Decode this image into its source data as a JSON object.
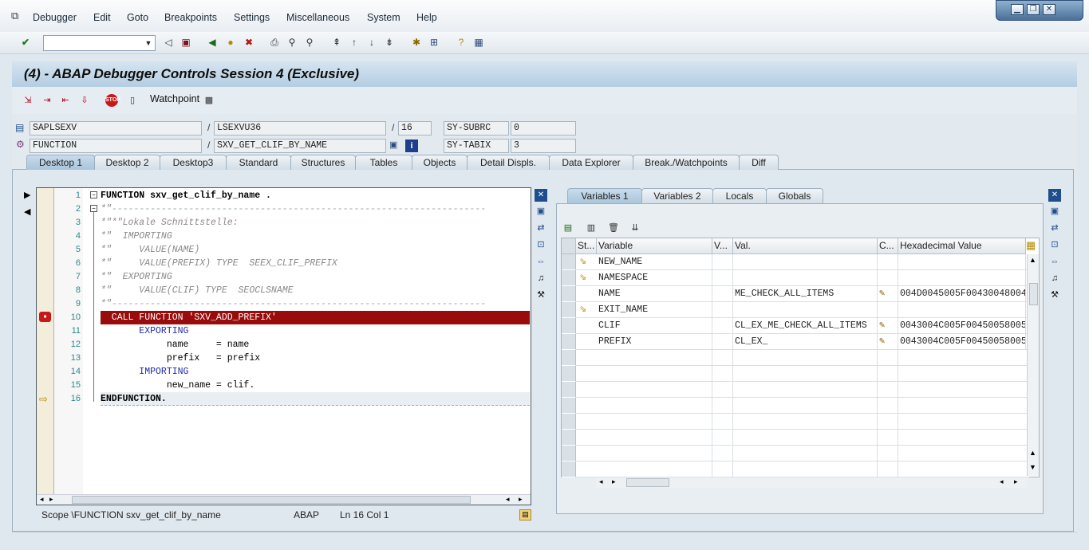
{
  "menubar": {
    "items": [
      "Debugger",
      "Edit",
      "Goto",
      "Breakpoints",
      "Settings",
      "Miscellaneous",
      "System",
      "Help"
    ]
  },
  "window_controls": {
    "minimize": "▁",
    "restore": "❐",
    "close": "✕"
  },
  "toolbar": {
    "command_field": ""
  },
  "header": {
    "title": "(4) - ABAP Debugger Controls Session 4 (Exclusive)"
  },
  "app_toolbar": {
    "watchpoint_label": "Watchpoint"
  },
  "fields": {
    "program": "SAPLSEXV",
    "include": "LSEXVU36",
    "line": "16",
    "event_type": "FUNCTION",
    "event": "SXV_GET_CLIF_BY_NAME",
    "sysvar1_name": "SY-SUBRC",
    "sysvar1_value": "0",
    "sysvar2_name": "SY-TABIX",
    "sysvar2_value": "3",
    "separator": "/"
  },
  "desktop_tabs": [
    "Desktop 1",
    "Desktop 2",
    "Desktop3",
    "Standard",
    "Structures",
    "Tables",
    "Objects",
    "Detail Displs.",
    "Data Explorer",
    "Break./Watchpoints",
    "Diff"
  ],
  "source": {
    "line_numbers": [
      "1",
      "2",
      "3",
      "4",
      "5",
      "6",
      "7",
      "8",
      "9",
      "10",
      "11",
      "12",
      "13",
      "14",
      "15",
      "16"
    ],
    "lines": [
      "FUNCTION sxv_get_clif_by_name .",
      "*\"",
      "*\"*\"Lokale Schnittstelle:",
      "*\"  IMPORTING",
      "*\"     VALUE(NAME)",
      "*\"     VALUE(PREFIX) TYPE  SEEX_CLIF_PREFIX",
      "*\"  EXPORTING",
      "*\"     VALUE(CLIF) TYPE  SEOCLSNAME",
      "*\"",
      "  CALL FUNCTION 'SXV_ADD_PREFIX'",
      "       EXPORTING",
      "            name     = name",
      "            prefix   = prefix",
      "       IMPORTING",
      "            new_name = clif.",
      "ENDFUNCTION."
    ]
  },
  "status_bar": {
    "scope": "Scope \\FUNCTION sxv_get_clif_by_name",
    "language": "ABAP",
    "position": "Ln  16 Col   1"
  },
  "variable_tabs": [
    "Variables 1",
    "Variables 2",
    "Locals",
    "Globals"
  ],
  "variables": {
    "columns": [
      "St...",
      "Variable",
      "V...",
      "Val.",
      "C...",
      "Hexadecimal Value"
    ],
    "rows": [
      {
        "variable": "NEW_NAME",
        "value": "",
        "hex": ""
      },
      {
        "variable": "NAMESPACE",
        "value": "",
        "hex": ""
      },
      {
        "variable": "NAME",
        "value": "ME_CHECK_ALL_ITEMS",
        "hex": "004D0045005F00430048004"
      },
      {
        "variable": "EXIT_NAME",
        "value": "",
        "hex": ""
      },
      {
        "variable": "CLIF",
        "value": "CL_EX_ME_CHECK_ALL_ITEMS",
        "hex": "0043004C005F00450058005"
      },
      {
        "variable": "PREFIX",
        "value": "CL_EX_",
        "hex": "0043004C005F00450058005"
      }
    ]
  },
  "colors": {
    "breakpoint_line": "#9a0b0b",
    "tab_active": "#b7cfe3"
  }
}
